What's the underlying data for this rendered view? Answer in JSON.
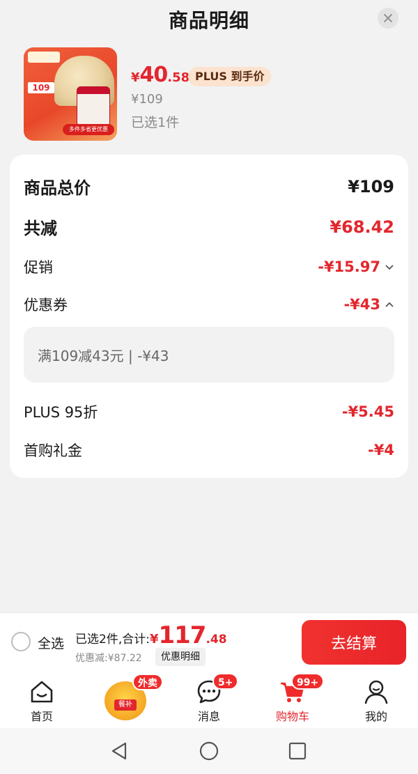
{
  "header": {
    "title": "商品明细"
  },
  "product": {
    "thumb_price": "109",
    "thumb_banner": "多件多省更优惠",
    "price_symbol": "¥",
    "price_int": "40",
    "price_dec": ".58",
    "plus_tag": "PLUS 到手价",
    "original_price": "¥109",
    "selected": "已选1件"
  },
  "breakdown": {
    "total_label": "商品总价",
    "total_value": "¥109",
    "reduce_label": "共减",
    "reduce_value": "¥68.42",
    "promo_label": "促销",
    "promo_value": "-¥15.97",
    "coupon_label": "优惠券",
    "coupon_value": "-¥43",
    "coupon_detail": "满109减43元 | -¥43",
    "plus_label": "PLUS 95折",
    "plus_value": "-¥5.45",
    "first_label": "首购礼金",
    "first_value": "-¥4"
  },
  "checkout": {
    "select_all": "全选",
    "total_prefix": "已选2件,合计:",
    "total_symbol": "¥",
    "total_int": "117",
    "total_dec": ".48",
    "discount": "优惠减:¥87.22",
    "detail_button": "优惠明细",
    "checkout_button": "去结算"
  },
  "tabs": [
    {
      "label": "首页",
      "icon": "home-icon"
    },
    {
      "label": "外卖",
      "icon": "meal-subsidy-icon",
      "badge": "外卖",
      "inner": "餐补"
    },
    {
      "label": "消息",
      "icon": "message-icon",
      "badge": "5+"
    },
    {
      "label": "购物车",
      "icon": "cart-icon",
      "badge": "99+",
      "active": true
    },
    {
      "label": "我的",
      "icon": "profile-icon"
    }
  ],
  "colors": {
    "accent": "#e3262d",
    "plus_tag_bg": "#fbe3cf",
    "background": "#f2f2f2"
  }
}
